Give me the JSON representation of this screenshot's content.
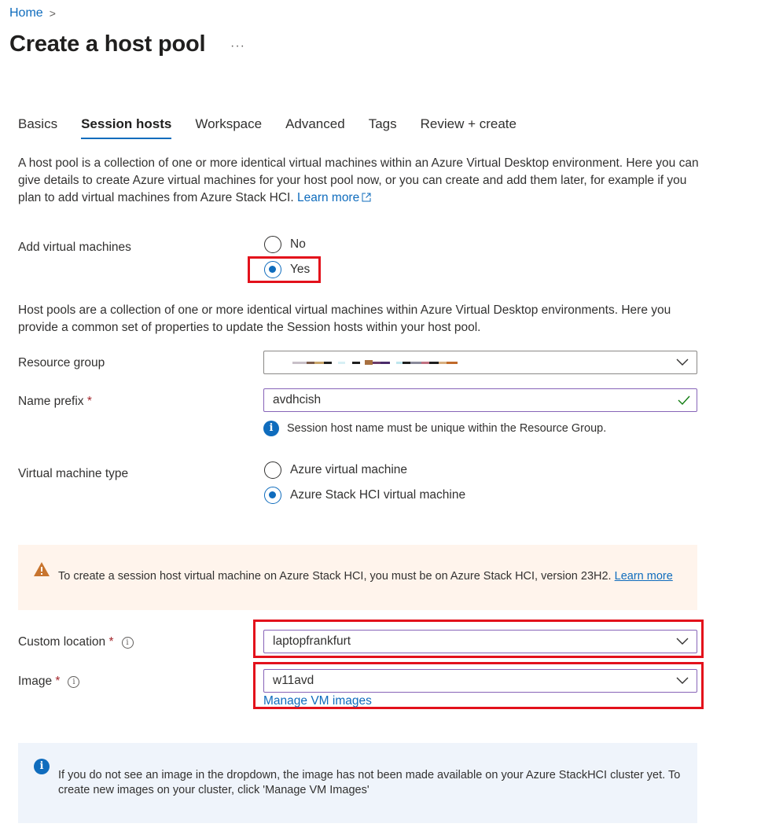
{
  "breadcrumb": {
    "home": "Home",
    "separator": ">"
  },
  "page": {
    "title": "Create a host pool",
    "more": "···"
  },
  "tabs": [
    {
      "label": "Basics"
    },
    {
      "label": "Session hosts"
    },
    {
      "label": "Workspace"
    },
    {
      "label": "Advanced"
    },
    {
      "label": "Tags"
    },
    {
      "label": "Review + create"
    }
  ],
  "intro": {
    "text": "A host pool is a collection of one or more identical virtual machines within an Azure Virtual Desktop environment. Here you can give details to create Azure virtual machines for your host pool now, or you can create and add them later, for example if you plan to add virtual machines from Azure Stack HCI.",
    "link": "Learn more"
  },
  "add_vms": {
    "label": "Add virtual machines",
    "options": [
      {
        "label": "No"
      },
      {
        "label": "Yes"
      }
    ],
    "selected": "Yes"
  },
  "description": "Host pools are a collection of one or more identical virtual machines within Azure Virtual Desktop environments. Here you provide a common set of properties to update the Session hosts within your host pool.",
  "resource_group": {
    "label": "Resource group"
  },
  "name_prefix": {
    "label": "Name prefix",
    "required": "*",
    "value": "avdhcish",
    "hint": "Session host name must be unique within the Resource Group."
  },
  "vm_type": {
    "label": "Virtual machine type",
    "options": [
      {
        "label": "Azure virtual machine"
      },
      {
        "label": "Azure Stack HCI virtual machine"
      }
    ],
    "selected": "Azure Stack HCI virtual machine"
  },
  "warning": {
    "text": "To create a session host virtual machine on Azure Stack HCI, you must be on Azure Stack HCI, version 23H2.",
    "link": "Learn more"
  },
  "custom_location": {
    "label": "Custom location",
    "required": "*",
    "info": "i",
    "value": "laptopfrankfurt"
  },
  "image": {
    "label": "Image",
    "required": "*",
    "info": "i",
    "value": "w11avd",
    "manage_link": "Manage VM images"
  },
  "info_note": {
    "icon": "i",
    "text": "If you do not see an image in the dropdown, the image has not been made available on your Azure StackHCI cluster yet. To create new images on your cluster, click 'Manage VM Images'"
  },
  "colors": {
    "accent": "#0f6cbd",
    "highlight": "#e3111b",
    "warning_bg": "#fff4ec",
    "info_bg": "#eff4fb",
    "warning_icon": "#c8742e"
  }
}
